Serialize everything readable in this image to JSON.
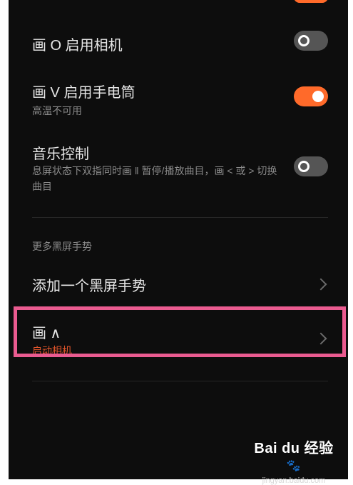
{
  "settings": [
    {
      "title": "画 O 启用相机",
      "subtitle": "",
      "toggle": "off"
    },
    {
      "title": "画 V 启用手电筒",
      "subtitle": "高温不可用",
      "toggle": "on"
    },
    {
      "title": "音乐控制",
      "subtitle": "息屏状态下双指同时画 ‖ 暂停/播放曲目，画 < 或 > 切换曲目",
      "toggle": "off"
    }
  ],
  "section": {
    "label": "更多黑屏手势"
  },
  "nav_items": [
    {
      "title": "添加一个黑屏手势",
      "subtitle": ""
    },
    {
      "title": "画 ∧",
      "subtitle": "启动相机"
    }
  ],
  "watermark": {
    "logo": "Bai du 经验",
    "paw": "🐾",
    "site": "jingyan.baidu.com"
  },
  "colors": {
    "accent": "#ff6a2a",
    "highlight": "#ea5b90",
    "background": "#0d0d0d"
  }
}
